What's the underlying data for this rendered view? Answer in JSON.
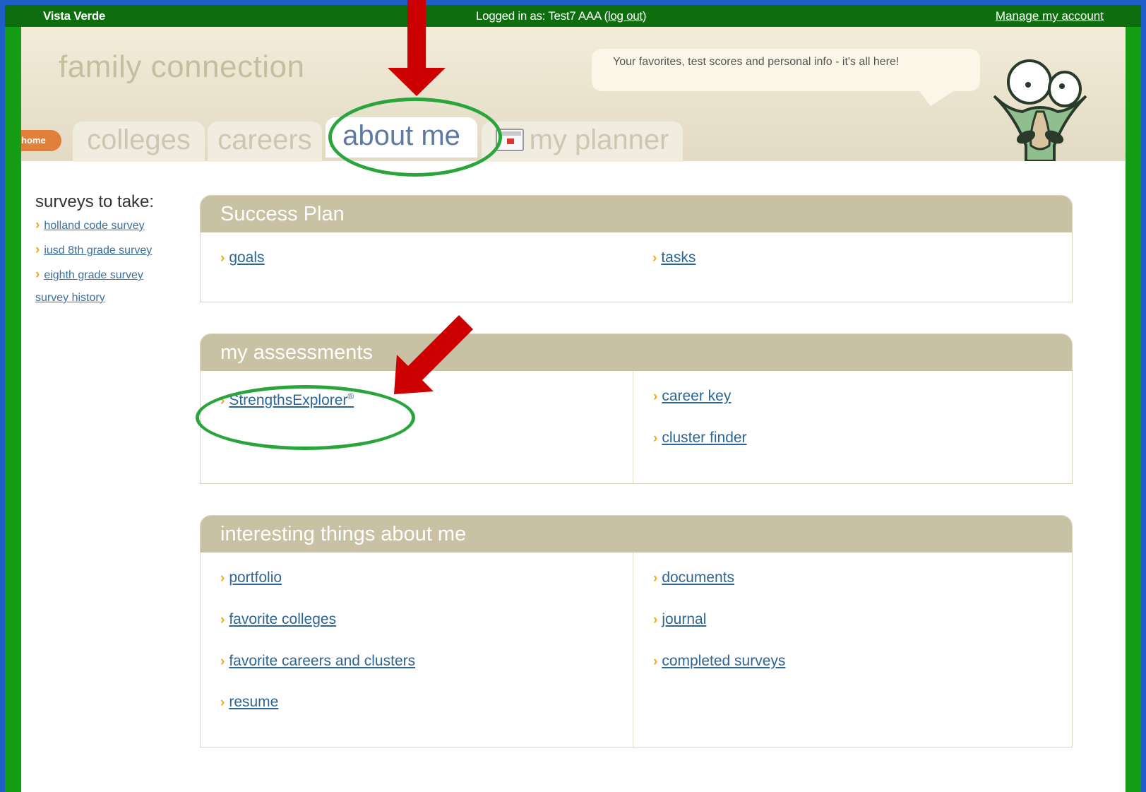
{
  "topbar": {
    "site": "Vista Verde",
    "login_prefix": "Logged in as: Test7 AAA (",
    "logout": "log out",
    "login_suffix": ")",
    "manage": "Manage my account"
  },
  "header": {
    "brand": "family connection",
    "bubble": "Your favorites, test scores and personal info - it's all here!"
  },
  "tabs": {
    "home": "home",
    "colleges": "colleges",
    "careers": "careers",
    "about_me": "about me",
    "my_planner": "my planner"
  },
  "sidebar": {
    "title": "surveys to take:",
    "items": [
      "holland code survey",
      "iusd 8th grade survey",
      "eighth grade survey"
    ],
    "history": "survey history"
  },
  "success_plan": {
    "title": "Success Plan",
    "left": [
      "goals"
    ],
    "right": [
      "tasks"
    ]
  },
  "assessments": {
    "title": "my assessments",
    "left": [
      "StrengthsExplorer"
    ],
    "left_sup": "®",
    "right": [
      "career key",
      "cluster finder"
    ]
  },
  "interesting": {
    "title": "interesting things about me",
    "left": [
      "portfolio",
      "favorite colleges",
      "favorite careers and clusters",
      "resume"
    ],
    "right": [
      "documents",
      "journal",
      "completed surveys"
    ]
  },
  "colors": {
    "frame": "#159d15",
    "topbar": "#0e6d0e",
    "section_header": "#c8c1a3",
    "annotation_arrow": "#cc0000",
    "annotation_ring": "#2aa53b"
  }
}
